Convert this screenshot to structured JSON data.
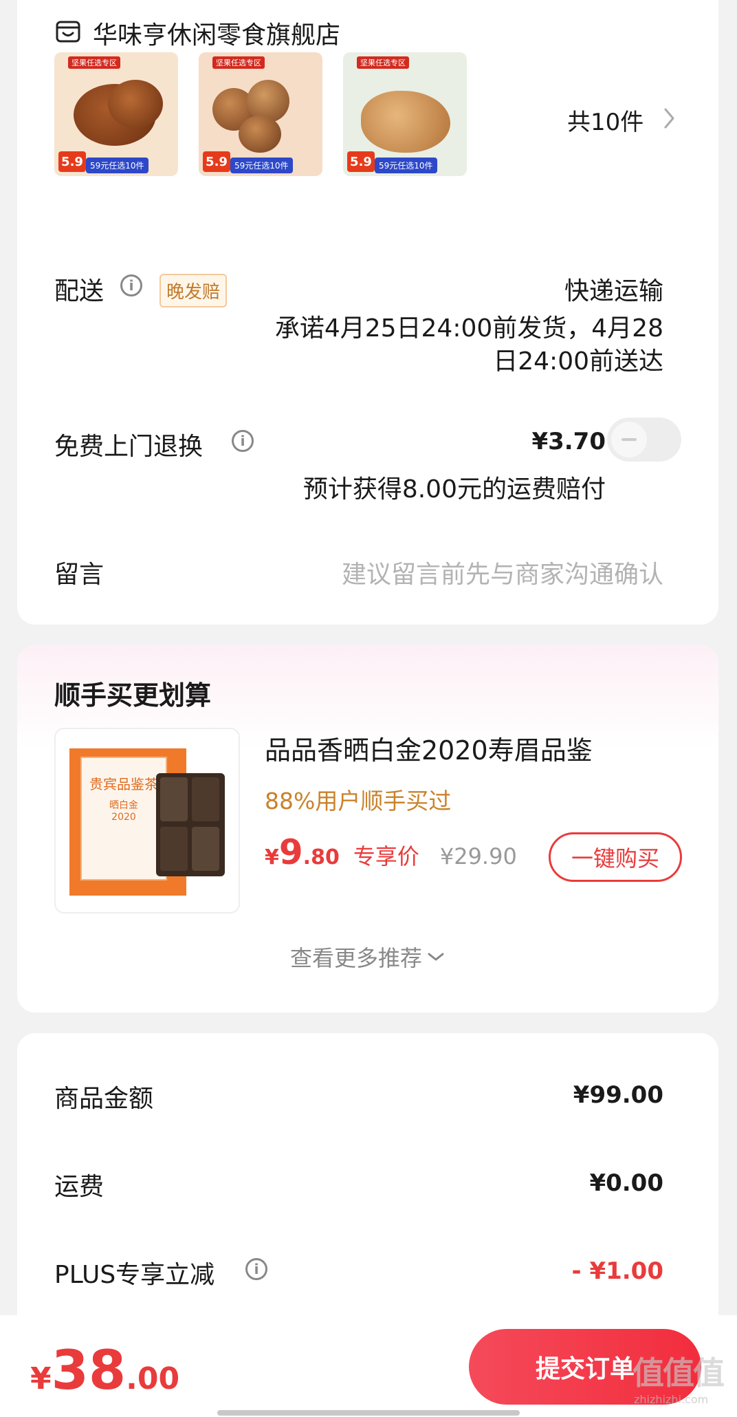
{
  "store": {
    "name": "华味亨休闲零食旗舰店",
    "icon": "store-icon"
  },
  "products": {
    "thumbnails": [
      {
        "label": "坚果任选专区",
        "price": "5.9",
        "promo": "59元任选10件"
      },
      {
        "label": "坚果任选专区",
        "price": "5.9",
        "promo": "59元任选10件"
      },
      {
        "label": "坚果任选专区",
        "price": "5.9",
        "promo": "59元任选10件"
      }
    ],
    "count_label": "共10件"
  },
  "delivery": {
    "label": "配送",
    "tag": "晚发赔",
    "method": "快递运输",
    "promise_line1": "承诺4月25日24:00前发货，4月28",
    "promise_line2": "日24:00前送达"
  },
  "return_service": {
    "label": "免费上门退换",
    "price": "¥3.70",
    "note": "预计获得8.00元的运费赔付",
    "enabled": false
  },
  "message": {
    "label": "留言",
    "placeholder": "建议留言前先与商家沟通确认"
  },
  "addon": {
    "title": "顺手买更划算",
    "item": {
      "name": "品品香晒白金2020寿眉品鉴",
      "social": "88%用户顺手买过",
      "price_symbol": "¥",
      "price_int": "9",
      "price_dec": ".80",
      "price_tag": "专享价",
      "original_price": "¥29.90",
      "buy_label": "一键购买",
      "package_text": "贵宾品鉴茶",
      "package_sub": "晒白金",
      "package_year": "2020"
    },
    "more_label": "查看更多推荐"
  },
  "summary": {
    "rows": [
      {
        "label": "商品金额",
        "value": "¥99.00"
      },
      {
        "label": "运费",
        "value": "¥0.00"
      },
      {
        "label": "PLUS专享立减",
        "value": "- ¥1.00"
      }
    ]
  },
  "footer": {
    "total_symbol": "¥",
    "total_int": "38",
    "total_dec": ".00",
    "submit_label": "提交订单",
    "watermark": "值值值",
    "watermark_sub": "zhizhizhi.com"
  },
  "colors": {
    "accent": "#e93b3b",
    "orange": "#c9822a",
    "muted": "#b3b3b3"
  }
}
